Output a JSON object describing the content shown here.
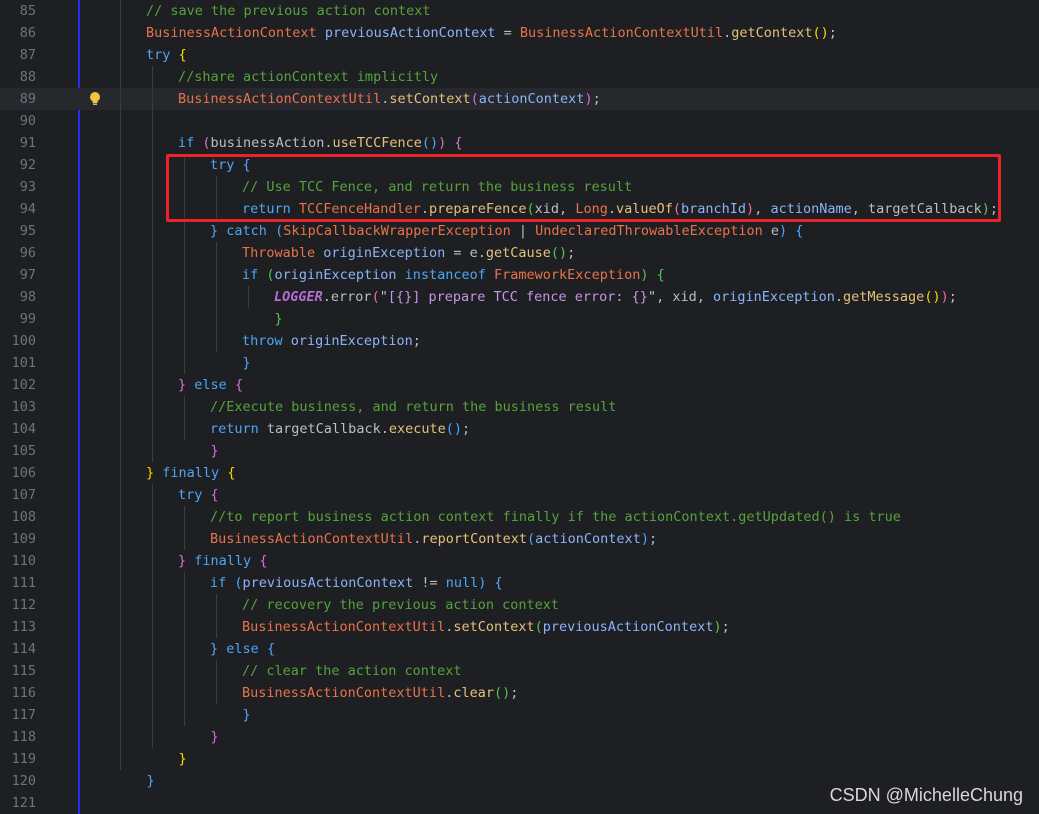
{
  "watermark": "CSDN @MichelleChung",
  "current_line": 89,
  "lines": [
    {
      "n": "85",
      "indent": 2,
      "tokens": [
        [
          "cm",
          "// save the previous action context"
        ]
      ]
    },
    {
      "n": "86",
      "indent": 2,
      "tokens": [
        [
          "ty",
          "BusinessActionContext"
        ],
        [
          "tx",
          " "
        ],
        [
          "vr",
          "previousActionContext"
        ],
        [
          "tx",
          " = "
        ],
        [
          "ty",
          "BusinessActionContextUtil"
        ],
        [
          "tx",
          "."
        ],
        [
          "fn",
          "getContext"
        ],
        [
          "b1",
          "()"
        ],
        [
          "tx",
          ";"
        ]
      ]
    },
    {
      "n": "87",
      "indent": 2,
      "tokens": [
        [
          "kw",
          "try"
        ],
        [
          "tx",
          " "
        ],
        [
          "b1",
          "{"
        ]
      ]
    },
    {
      "n": "88",
      "indent": 3,
      "tokens": [
        [
          "cm",
          "//share actionContext implicitly"
        ]
      ]
    },
    {
      "n": "89",
      "indent": 3,
      "bulb": true,
      "tokens": [
        [
          "ty",
          "BusinessActionContextUtil"
        ],
        [
          "tx",
          "."
        ],
        [
          "fn",
          "setContext"
        ],
        [
          "b2",
          "("
        ],
        [
          "vr",
          "actionContext"
        ],
        [
          "b2",
          ")"
        ],
        [
          "tx",
          ";"
        ]
      ]
    },
    {
      "n": "90",
      "indent": 3,
      "tokens": []
    },
    {
      "n": "91",
      "indent": 3,
      "tokens": [
        [
          "kw",
          "if"
        ],
        [
          "tx",
          " "
        ],
        [
          "b2",
          "("
        ],
        [
          "tx",
          "businessAction."
        ],
        [
          "fn",
          "useTCCFence"
        ],
        [
          "b3",
          "()"
        ],
        [
          "b2",
          ")"
        ],
        [
          "tx",
          " "
        ],
        [
          "b2",
          "{"
        ]
      ]
    },
    {
      "n": "92",
      "indent": 4,
      "tokens": [
        [
          "kw",
          "try"
        ],
        [
          "tx",
          " "
        ],
        [
          "b3",
          "{"
        ]
      ]
    },
    {
      "n": "93",
      "indent": 5,
      "tokens": [
        [
          "cm",
          "// Use TCC Fence, and return the business result"
        ]
      ]
    },
    {
      "n": "94",
      "indent": 5,
      "tokens": [
        [
          "kw",
          "return"
        ],
        [
          "tx",
          " "
        ],
        [
          "ty",
          "TCCFenceHandler"
        ],
        [
          "tx",
          "."
        ],
        [
          "fn",
          "prepareFence"
        ],
        [
          "b4",
          "("
        ],
        [
          "tx",
          "xid, "
        ],
        [
          "ty",
          "Long"
        ],
        [
          "tx",
          "."
        ],
        [
          "fn",
          "valueOf"
        ],
        [
          "b5",
          "("
        ],
        [
          "vr",
          "branchId"
        ],
        [
          "b5",
          ")"
        ],
        [
          "tx",
          ", "
        ],
        [
          "vr",
          "actionName"
        ],
        [
          "tx",
          ", targetCallback"
        ],
        [
          "b4",
          ")"
        ],
        [
          "tx",
          ";"
        ]
      ]
    },
    {
      "n": "95",
      "indent": 4,
      "tokens": [
        [
          "b3",
          "}"
        ],
        [
          "tx",
          " "
        ],
        [
          "kw",
          "catch"
        ],
        [
          "tx",
          " "
        ],
        [
          "b3",
          "("
        ],
        [
          "ty",
          "SkipCallbackWrapperException"
        ],
        [
          "tx",
          " | "
        ],
        [
          "ty",
          "UndeclaredThrowableException"
        ],
        [
          "tx",
          " e"
        ],
        [
          "b3",
          ")"
        ],
        [
          "tx",
          " "
        ],
        [
          "b3",
          "{"
        ]
      ]
    },
    {
      "n": "96",
      "indent": 5,
      "tokens": [
        [
          "ty",
          "Throwable"
        ],
        [
          "tx",
          " "
        ],
        [
          "vr",
          "originException"
        ],
        [
          "tx",
          " = e."
        ],
        [
          "fn",
          "getCause"
        ],
        [
          "b4",
          "()"
        ],
        [
          "tx",
          ";"
        ]
      ]
    },
    {
      "n": "97",
      "indent": 5,
      "tokens": [
        [
          "kw",
          "if"
        ],
        [
          "tx",
          " "
        ],
        [
          "b4",
          "("
        ],
        [
          "vr",
          "originException"
        ],
        [
          "tx",
          " "
        ],
        [
          "kw",
          "instanceof"
        ],
        [
          "tx",
          " "
        ],
        [
          "ty",
          "FrameworkException"
        ],
        [
          "b4",
          ")"
        ],
        [
          "tx",
          " "
        ],
        [
          "b4",
          "{"
        ]
      ]
    },
    {
      "n": "98",
      "indent": 6,
      "tokens": [
        [
          "lg",
          "LOGGER"
        ],
        [
          "tx",
          "."
        ],
        [
          "tx",
          "error"
        ],
        [
          "b5",
          "("
        ],
        [
          "tx",
          "\""
        ],
        [
          "st",
          "[{}] prepare TCC fence error: {}"
        ],
        [
          "tx",
          "\", xid, "
        ],
        [
          "vr",
          "originException"
        ],
        [
          "tx",
          "."
        ],
        [
          "fn",
          "getMessage"
        ],
        [
          "b1",
          "()"
        ],
        [
          "b5",
          ")"
        ],
        [
          "tx",
          ";"
        ]
      ]
    },
    {
      "n": "99",
      "indent": 5,
      "tokens": [
        [
          "tx",
          "    "
        ],
        [
          "b4",
          "}"
        ]
      ]
    },
    {
      "n": "100",
      "indent": 5,
      "tokens": [
        [
          "kw",
          "throw"
        ],
        [
          "tx",
          " "
        ],
        [
          "vr",
          "originException"
        ],
        [
          "tx",
          ";"
        ]
      ]
    },
    {
      "n": "101",
      "indent": 4,
      "tokens": [
        [
          "tx",
          "    "
        ],
        [
          "b3",
          "}"
        ]
      ]
    },
    {
      "n": "102",
      "indent": 3,
      "tokens": [
        [
          "b2",
          "}"
        ],
        [
          "tx",
          " "
        ],
        [
          "kw",
          "else"
        ],
        [
          "tx",
          " "
        ],
        [
          "b2",
          "{"
        ]
      ]
    },
    {
      "n": "103",
      "indent": 4,
      "tokens": [
        [
          "cm",
          "//Execute business, and return the business result"
        ]
      ]
    },
    {
      "n": "104",
      "indent": 4,
      "tokens": [
        [
          "kw",
          "return"
        ],
        [
          "tx",
          " targetCallback."
        ],
        [
          "fn",
          "execute"
        ],
        [
          "b3",
          "()"
        ],
        [
          "tx",
          ";"
        ]
      ]
    },
    {
      "n": "105",
      "indent": 3,
      "tokens": [
        [
          "tx",
          "    "
        ],
        [
          "b2",
          "}"
        ]
      ]
    },
    {
      "n": "106",
      "indent": 2,
      "tokens": [
        [
          "b1",
          "}"
        ],
        [
          "tx",
          " "
        ],
        [
          "kw",
          "finally"
        ],
        [
          "tx",
          " "
        ],
        [
          "b1",
          "{"
        ]
      ]
    },
    {
      "n": "107",
      "indent": 3,
      "tokens": [
        [
          "kw",
          "try"
        ],
        [
          "tx",
          " "
        ],
        [
          "b2",
          "{"
        ]
      ]
    },
    {
      "n": "108",
      "indent": 4,
      "tokens": [
        [
          "cm",
          "//to report business action context finally if the actionContext.getUpdated() is true"
        ]
      ]
    },
    {
      "n": "109",
      "indent": 4,
      "tokens": [
        [
          "ty",
          "BusinessActionContextUtil"
        ],
        [
          "tx",
          "."
        ],
        [
          "fn",
          "reportContext"
        ],
        [
          "b3",
          "("
        ],
        [
          "vr",
          "actionContext"
        ],
        [
          "b3",
          ")"
        ],
        [
          "tx",
          ";"
        ]
      ]
    },
    {
      "n": "110",
      "indent": 3,
      "tokens": [
        [
          "b2",
          "}"
        ],
        [
          "tx",
          " "
        ],
        [
          "kw",
          "finally"
        ],
        [
          "tx",
          " "
        ],
        [
          "b2",
          "{"
        ]
      ]
    },
    {
      "n": "111",
      "indent": 4,
      "tokens": [
        [
          "kw",
          "if"
        ],
        [
          "tx",
          " "
        ],
        [
          "b3",
          "("
        ],
        [
          "vr",
          "previousActionContext"
        ],
        [
          "tx",
          " != "
        ],
        [
          "kw",
          "null"
        ],
        [
          "b3",
          ")"
        ],
        [
          "tx",
          " "
        ],
        [
          "b3",
          "{"
        ]
      ]
    },
    {
      "n": "112",
      "indent": 5,
      "tokens": [
        [
          "cm",
          "// recovery the previous action context"
        ]
      ]
    },
    {
      "n": "113",
      "indent": 5,
      "tokens": [
        [
          "ty",
          "BusinessActionContextUtil"
        ],
        [
          "tx",
          "."
        ],
        [
          "fn",
          "setContext"
        ],
        [
          "b4",
          "("
        ],
        [
          "vr",
          "previousActionContext"
        ],
        [
          "b4",
          ")"
        ],
        [
          "tx",
          ";"
        ]
      ]
    },
    {
      "n": "114",
      "indent": 4,
      "tokens": [
        [
          "b3",
          "}"
        ],
        [
          "tx",
          " "
        ],
        [
          "kw",
          "else"
        ],
        [
          "tx",
          " "
        ],
        [
          "b3",
          "{"
        ]
      ]
    },
    {
      "n": "115",
      "indent": 5,
      "tokens": [
        [
          "cm",
          "// clear the action context"
        ]
      ]
    },
    {
      "n": "116",
      "indent": 5,
      "tokens": [
        [
          "ty",
          "BusinessActionContextUtil"
        ],
        [
          "tx",
          "."
        ],
        [
          "fn",
          "clear"
        ],
        [
          "b4",
          "()"
        ],
        [
          "tx",
          ";"
        ]
      ]
    },
    {
      "n": "117",
      "indent": 4,
      "tokens": [
        [
          "tx",
          "    "
        ],
        [
          "b3",
          "}"
        ]
      ]
    },
    {
      "n": "118",
      "indent": 3,
      "tokens": [
        [
          "tx",
          "    "
        ],
        [
          "b2",
          "}"
        ]
      ]
    },
    {
      "n": "119",
      "indent": 2,
      "tokens": [
        [
          "tx",
          "    "
        ],
        [
          "b1",
          "}"
        ]
      ]
    },
    {
      "n": "120",
      "indent": 1,
      "tokens": [
        [
          "tx",
          "    "
        ],
        [
          "b3",
          "}"
        ]
      ]
    },
    {
      "n": "121",
      "indent": 0,
      "tokens": []
    }
  ]
}
